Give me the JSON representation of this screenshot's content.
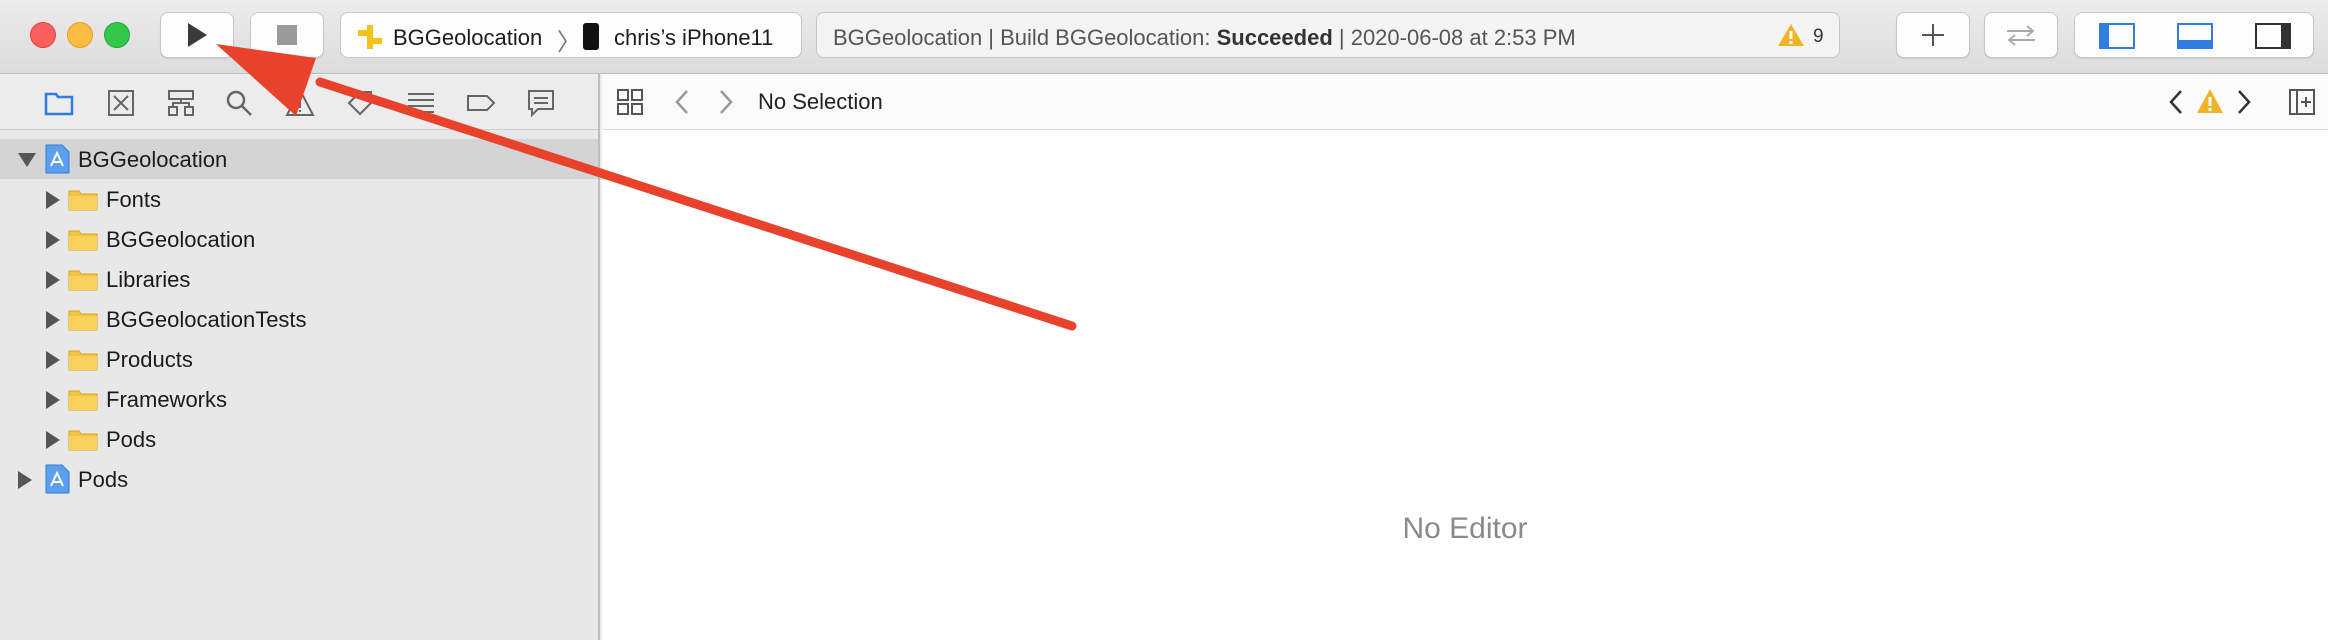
{
  "window": {
    "traffic_lights": [
      "close",
      "minimize",
      "zoom"
    ]
  },
  "toolbar": {
    "run_icon": "play-icon",
    "stop_icon": "stop-icon",
    "scheme": {
      "target": "BGGeolocation",
      "device": "chris’s iPhone11"
    },
    "activity": {
      "prefix": "BGGeolocation | Build BGGeolocation: ",
      "status": "Succeeded",
      "suffix": " | 2020-06-08 at 2:53 PM",
      "warning_count": "9"
    },
    "right_buttons": [
      "add-icon",
      "code-review-icon",
      "navigator-toggle-icon",
      "debug-area-toggle-icon",
      "inspector-toggle-icon"
    ]
  },
  "navigator": {
    "tabs": [
      "project",
      "source-control",
      "symbol",
      "find",
      "issue",
      "test",
      "debug",
      "breakpoint",
      "report"
    ],
    "tree": [
      {
        "label": "BGGeolocation",
        "kind": "project",
        "level": 0,
        "expanded": true,
        "selected": true
      },
      {
        "label": "Fonts",
        "kind": "folder",
        "level": 1,
        "expanded": false
      },
      {
        "label": "BGGeolocation",
        "kind": "folder",
        "level": 1,
        "expanded": false
      },
      {
        "label": "Libraries",
        "kind": "folder",
        "level": 1,
        "expanded": false
      },
      {
        "label": "BGGeolocationTests",
        "kind": "folder",
        "level": 1,
        "expanded": false
      },
      {
        "label": "Products",
        "kind": "folder",
        "level": 1,
        "expanded": false
      },
      {
        "label": "Frameworks",
        "kind": "folder",
        "level": 1,
        "expanded": false
      },
      {
        "label": "Pods",
        "kind": "folder",
        "level": 1,
        "expanded": false
      },
      {
        "label": "Pods",
        "kind": "project",
        "level": 0,
        "expanded": false
      }
    ]
  },
  "editor": {
    "jump_label": "No Selection",
    "placeholder": "No Editor"
  },
  "colors": {
    "accent": "#2f7de1",
    "annotation_arrow": "#e8412c",
    "folder": "#f5c542",
    "warning": "#f0b429"
  }
}
